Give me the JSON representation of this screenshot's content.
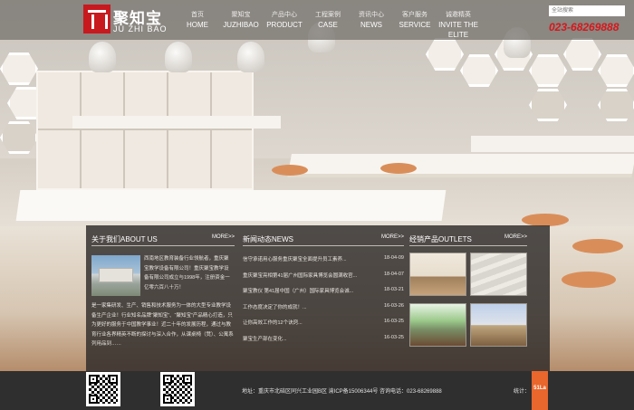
{
  "header": {
    "logo_cn": "聚知宝",
    "logo_en": "JU ZHI BAO",
    "nav": [
      {
        "cn": "首页",
        "en": "HOME"
      },
      {
        "cn": "聚知宝",
        "en": "JUZHIBAO"
      },
      {
        "cn": "产品中心",
        "en": "PRODUCT"
      },
      {
        "cn": "工程案例",
        "en": "CASE"
      },
      {
        "cn": "资讯中心",
        "en": "NEWS"
      },
      {
        "cn": "客户服务",
        "en": "SERVICE"
      },
      {
        "cn": "诚邀精英",
        "en": "INVITE THE ELITE"
      }
    ],
    "search_placeholder": "全站搜索",
    "phone": "023-68269888"
  },
  "about": {
    "title": "关于我们ABOUT US",
    "more": "MORE>>",
    "text_a": "西南地区教育装备行业领航者，重庆聚宝教学设备有限公司！重庆聚宝教学设备有限公司成立与1998年，注册资金一亿零六百八十万！",
    "text_b": "是一家集研发、生产、销售和技术服务为一体的大型专业教学设备生产企业！行业知名品牌“聚知宝”、“聚知宝”产品精心打造，只为更好的服务于中国教学事业！近二十年的发展历程，通过与教育行业各界精英不断的探讨与深入合作，从课桌椅（凳）、公寓系列用品到……"
  },
  "news": {
    "title": "新闻动态NEWS",
    "more": "MORE>>",
    "items": [
      {
        "title": "信守承诺用心服务重庆聚宝全面提升员工素养...",
        "date": "18-04-09"
      },
      {
        "title": "重庆聚宝亮相第41届广州国际家具博览会圆满收官...",
        "date": "18-04-07"
      },
      {
        "title": "聚宝教仪 第41届中国（广州）国际家具博览会诚...",
        "date": "18-03-21"
      },
      {
        "title": "工作态度决定了你的成就！...",
        "date": "16-03-26"
      },
      {
        "title": "让你高效工作的12个诀窍...",
        "date": "16-03-25"
      },
      {
        "title": "聚宝生产部在变化...",
        "date": "16-03-25"
      }
    ]
  },
  "outlets": {
    "title": "经销产品OUTLETS",
    "more": "MORE>>"
  },
  "footer": {
    "address": "地址：重庆市北碚区同兴工业园B区  渝ICP备15006344号  咨询电话：023-68269888",
    "stats_label": "统计：",
    "stats_badge": "51La"
  }
}
